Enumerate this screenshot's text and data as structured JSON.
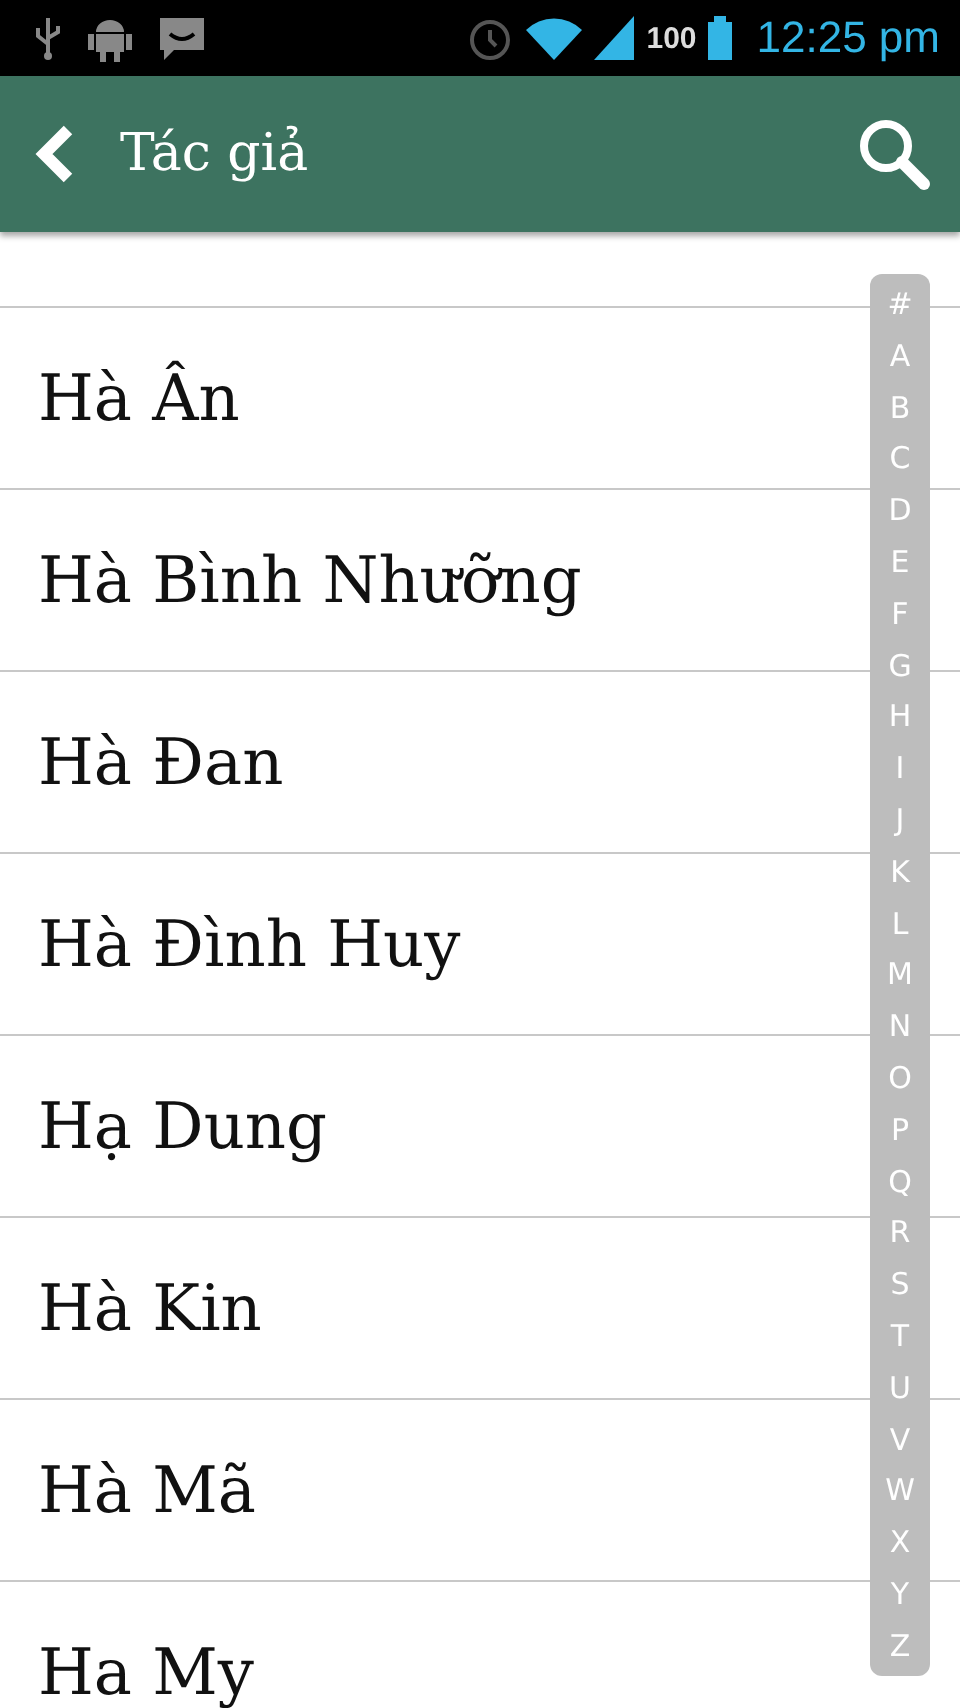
{
  "status_bar": {
    "battery": "100",
    "time": "12:25 pm"
  },
  "header": {
    "title": "Tác giả"
  },
  "authors": [
    "Hà Ân",
    "Hà Bình Nhưỡng",
    "Hà Đan",
    "Hà Đình Huy",
    "Hạ Dung",
    "Hà Kin",
    "Hà Mã",
    "Ha My"
  ],
  "index_letters": [
    "#",
    "A",
    "B",
    "C",
    "D",
    "E",
    "F",
    "G",
    "H",
    "I",
    "J",
    "K",
    "L",
    "M",
    "N",
    "O",
    "P",
    "Q",
    "R",
    "S",
    "T",
    "U",
    "V",
    "W",
    "X",
    "Y",
    "Z"
  ]
}
